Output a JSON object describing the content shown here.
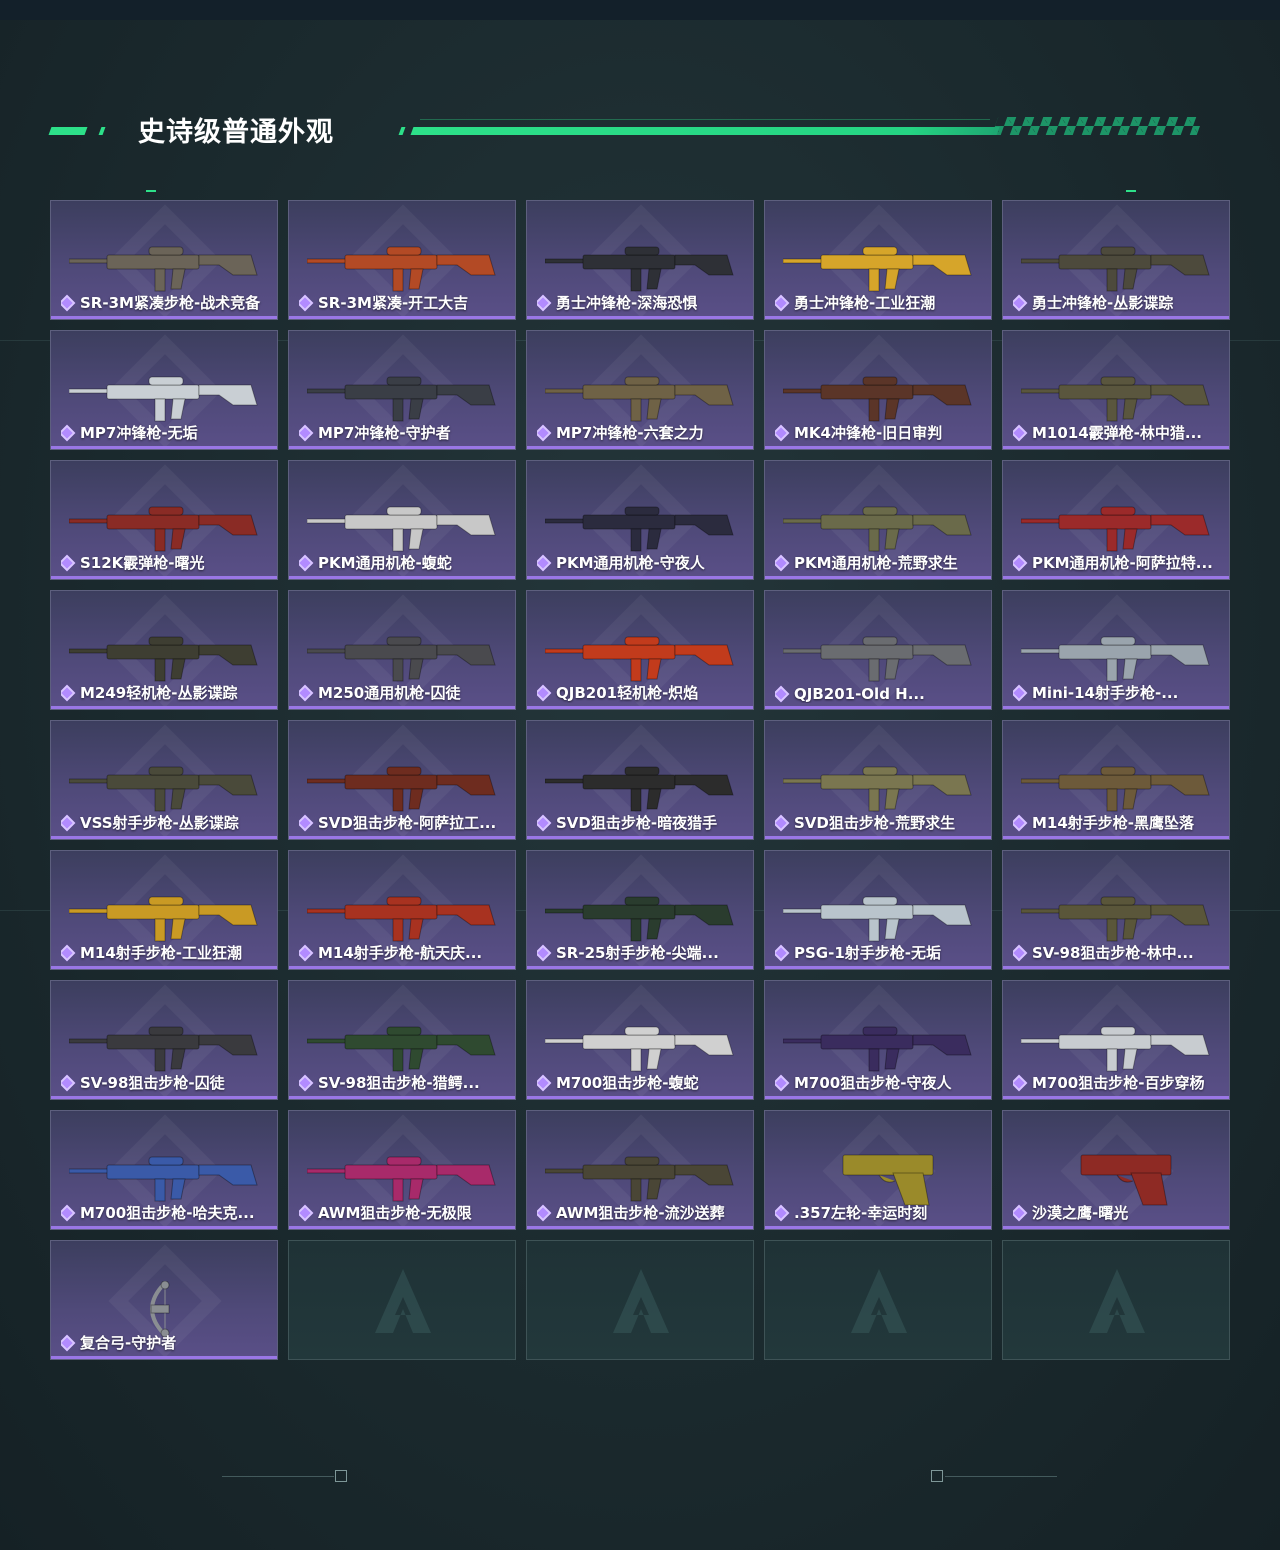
{
  "header": {
    "title": "史诗级普通外观"
  },
  "items": [
    {
      "label": "SR-3M紧凑步枪-战术竞备",
      "color": "#6b6458"
    },
    {
      "label": "SR-3M紧凑-开工大吉",
      "color": "#b34a25"
    },
    {
      "label": "勇士冲锋枪-深海恐惧",
      "color": "#2e3036"
    },
    {
      "label": "勇士冲锋枪-工业狂潮",
      "color": "#d6a52a"
    },
    {
      "label": "勇士冲锋枪-丛影谍踪",
      "color": "#4d4a3c"
    },
    {
      "label": "MP7冲锋枪-无垢",
      "color": "#c9cfd4"
    },
    {
      "label": "MP7冲锋枪-守护者",
      "color": "#3a3e46"
    },
    {
      "label": "MP7冲锋枪-六套之力",
      "color": "#6f6246"
    },
    {
      "label": "MK4冲锋枪-旧日审判",
      "color": "#5b3528"
    },
    {
      "label": "M1014霰弹枪-林中猎...",
      "color": "#5a563e"
    },
    {
      "label": "S12K霰弹枪-曙光",
      "color": "#8a2b25"
    },
    {
      "label": "PKM通用机枪-蝮蛇",
      "color": "#c8c8c8"
    },
    {
      "label": "PKM通用机枪-守夜人",
      "color": "#2b2b3e"
    },
    {
      "label": "PKM通用机枪-荒野求生",
      "color": "#6a6a4a"
    },
    {
      "label": "PKM通用机枪-阿萨拉特...",
      "color": "#9b2a2a"
    },
    {
      "label": "M249轻机枪-丛影谍踪",
      "color": "#3e3e32"
    },
    {
      "label": "M250通用机枪-囚徒",
      "color": "#4a4a4e"
    },
    {
      "label": "QJB201轻机枪-炽焰",
      "color": "#c23b1c"
    },
    {
      "label": "QJB201-Old H...",
      "color": "#6a6c70"
    },
    {
      "label": "Mini-14射手步枪-...",
      "color": "#9aa4ad"
    },
    {
      "label": "VSS射手步枪-丛影谍踪",
      "color": "#4a4a3a"
    },
    {
      "label": "SVD狙击步枪-阿萨拉工...",
      "color": "#6e2c1f"
    },
    {
      "label": "SVD狙击步枪-暗夜猎手",
      "color": "#2c2c2c"
    },
    {
      "label": "SVD狙击步枪-荒野求生",
      "color": "#7a7650"
    },
    {
      "label": "M14射手步枪-黑鹰坠落",
      "color": "#6d5a3a"
    },
    {
      "label": "M14射手步枪-工业狂潮",
      "color": "#c99a24"
    },
    {
      "label": "M14射手步枪-航天庆...",
      "color": "#a83220"
    },
    {
      "label": "SR-25射手步枪-尖端...",
      "color": "#2a3c2e"
    },
    {
      "label": "PSG-1射手步枪-无垢",
      "color": "#b9c4cc"
    },
    {
      "label": "SV-98狙击步枪-林中...",
      "color": "#5a563a"
    },
    {
      "label": "SV-98狙击步枪-囚徒",
      "color": "#3a3a3e"
    },
    {
      "label": "SV-98狙击步枪-猎鳄...",
      "color": "#2f4a30"
    },
    {
      "label": "M700狙击步枪-蝮蛇",
      "color": "#d0d0d0"
    },
    {
      "label": "M700狙击步枪-守夜人",
      "color": "#3a2c5e"
    },
    {
      "label": "M700狙击步枪-百步穿杨",
      "color": "#c8ccd0"
    },
    {
      "label": "M700狙击步枪-哈夫克...",
      "color": "#3a5aa8"
    },
    {
      "label": "AWM狙击步枪-无极限",
      "color": "#a82a6a"
    },
    {
      "label": "AWM狙击步枪-流沙送葬",
      "color": "#4a4636"
    },
    {
      "label": ".357左轮-幸运时刻",
      "color": "#9a8a2a"
    },
    {
      "label": "沙漠之鹰-曙光",
      "color": "#8e2a24"
    },
    {
      "label": "复合弓-守护者",
      "color": "#8a8e92"
    }
  ],
  "empty_slots": 4,
  "icons": {
    "label_icon": "purple-diamond-icon",
    "empty_icon": "brand-triangle-icon"
  },
  "colors": {
    "accent": "#2de089",
    "card_bottom": "#9a77e6",
    "gem": "#b28bff"
  }
}
